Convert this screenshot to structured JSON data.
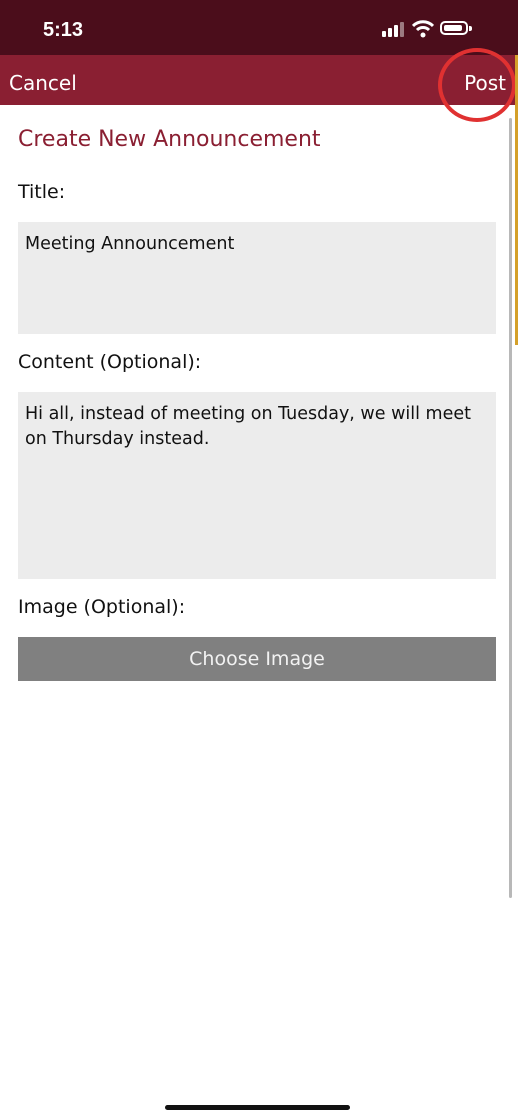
{
  "status": {
    "time": "5:13"
  },
  "nav": {
    "cancel_label": "Cancel",
    "post_label": "Post"
  },
  "form": {
    "heading": "Create New Announcement",
    "title_label": "Title:",
    "title_value": "Meeting Announcement",
    "content_label": "Content (Optional):",
    "content_value": "Hi all, instead of meeting on Tuesday, we will meet on Thursday instead.",
    "image_label": "Image (Optional):",
    "choose_image_label": "Choose Image"
  },
  "colors": {
    "brand": "#8a1f32",
    "status_bar": "#4b0d1b",
    "highlight": "#e03131"
  }
}
